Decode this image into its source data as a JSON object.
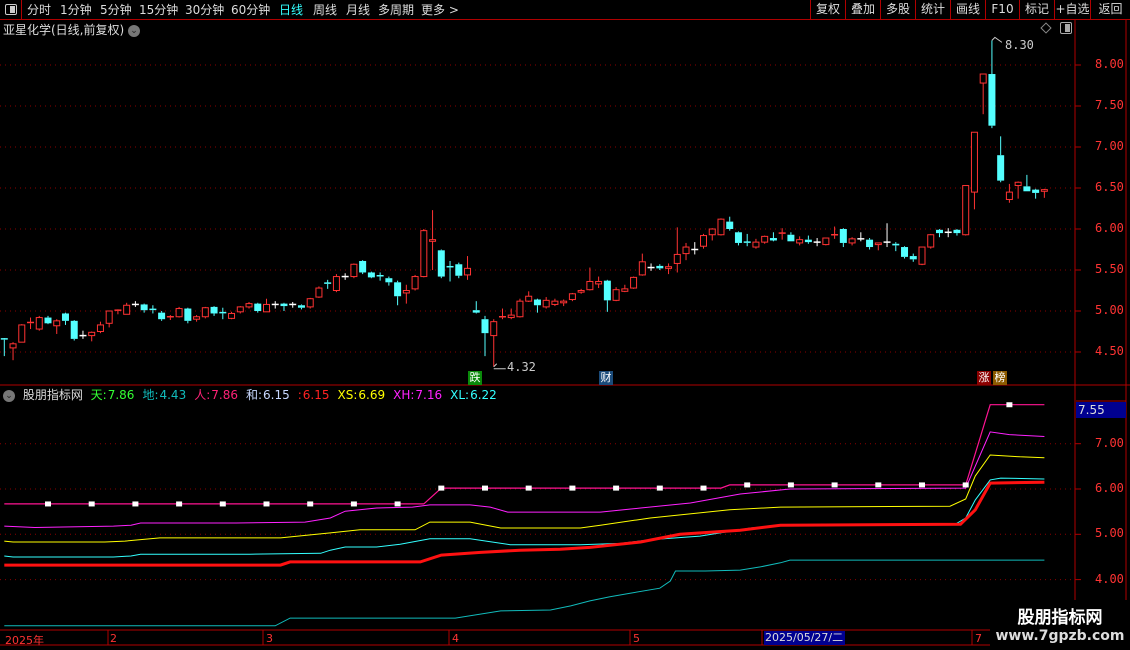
{
  "toolbar": {
    "periods": [
      "分时",
      "1分钟",
      "5分钟",
      "15分钟",
      "30分钟",
      "60分钟",
      "日线",
      "周线",
      "月线",
      "多周期",
      "更多 >"
    ],
    "active_period": "日线",
    "right_buttons": [
      "复权",
      "叠加",
      "多股",
      "统计",
      "画线",
      "F10",
      "标记",
      "+自选",
      "返回"
    ]
  },
  "stock": {
    "title": "亚星化学(日线,前复权)"
  },
  "price_axis": {
    "labels": [
      "8.00",
      "7.50",
      "7.00",
      "6.50",
      "6.00",
      "5.50",
      "5.00",
      "4.50"
    ],
    "values": [
      8,
      7.5,
      7,
      6.5,
      6,
      5.5,
      5,
      4.5
    ]
  },
  "annotations": {
    "high": "8.30",
    "low": "4.32",
    "badges": [
      "跌",
      "财",
      "涨",
      "榜"
    ]
  },
  "indicator": {
    "name": "股朋指标网",
    "items": [
      {
        "label": "天:",
        "value": "7.86",
        "color": "#33ff33"
      },
      {
        "label": "地:",
        "value": "4.43",
        "color": "#11bbbb"
      },
      {
        "label": "人:",
        "value": "7.86",
        "color": "#ff2277"
      },
      {
        "label": "和:",
        "value": "6.15",
        "color": "#c8d8ff"
      },
      {
        "label": ":",
        "value": "6.15",
        "color": "#ff2222"
      },
      {
        "label": "XS:",
        "value": "6.69",
        "color": "#ffff00"
      },
      {
        "label": "XH:",
        "value": "7.16",
        "color": "#ff22ff"
      },
      {
        "label": "XL:",
        "value": "6.22",
        "color": "#33ffff"
      }
    ],
    "axis_labels": [
      "7.00",
      "6.00",
      "5.00",
      "4.00"
    ],
    "axis_values": [
      7,
      6,
      5,
      4
    ],
    "cursor_value": "7.55"
  },
  "date_axis": {
    "labels": [
      "2025年",
      "2",
      "3",
      "4",
      "5",
      "7"
    ],
    "cursor_date": "2025/05/27/二"
  },
  "watermark": {
    "name": "股朋指标网",
    "url": "www.7gpzb.com"
  },
  "colors": {
    "up": "#ff3333",
    "down": "#54ffff",
    "grid": "#8b0000",
    "frame": "#b00000"
  },
  "chart_data": {
    "type": "candlestick",
    "ohlc": [
      [
        4.66,
        4.67,
        4.45,
        4.65
      ],
      [
        4.55,
        4.62,
        4.4,
        4.6
      ],
      [
        4.62,
        4.84,
        4.62,
        4.83
      ],
      [
        4.85,
        4.92,
        4.78,
        4.86
      ],
      [
        4.78,
        4.94,
        4.76,
        4.92
      ],
      [
        4.92,
        4.94,
        4.84,
        4.85
      ],
      [
        4.82,
        4.9,
        4.72,
        4.88
      ],
      [
        4.97,
        4.98,
        4.83,
        4.88
      ],
      [
        4.88,
        4.89,
        4.64,
        4.66
      ],
      [
        4.7,
        4.76,
        4.66,
        4.7
      ],
      [
        4.7,
        4.75,
        4.63,
        4.74
      ],
      [
        4.75,
        4.87,
        4.73,
        4.83
      ],
      [
        4.85,
        5.0,
        4.8,
        5.0
      ],
      [
        5.0,
        5.02,
        4.96,
        5.01
      ],
      [
        4.96,
        5.1,
        4.96,
        5.07
      ],
      [
        5.08,
        5.12,
        5.05,
        5.08
      ],
      [
        5.08,
        5.09,
        4.98,
        5.01
      ],
      [
        5.02,
        5.07,
        4.97,
        5.01
      ],
      [
        4.98,
        5.0,
        4.88,
        4.9
      ],
      [
        4.92,
        4.95,
        4.89,
        4.93
      ],
      [
        4.93,
        5.05,
        4.92,
        5.03
      ],
      [
        5.03,
        5.04,
        4.85,
        4.88
      ],
      [
        4.9,
        4.95,
        4.87,
        4.93
      ],
      [
        4.93,
        5.05,
        4.91,
        5.04
      ],
      [
        5.05,
        5.06,
        4.94,
        4.97
      ],
      [
        4.98,
        5.04,
        4.9,
        4.97
      ],
      [
        4.91,
        4.99,
        4.9,
        4.97
      ],
      [
        4.99,
        5.06,
        4.97,
        5.05
      ],
      [
        5.05,
        5.11,
        5.03,
        5.09
      ],
      [
        5.09,
        5.1,
        4.98,
        5.0
      ],
      [
        4.99,
        5.15,
        4.99,
        5.08
      ],
      [
        5.08,
        5.12,
        5.03,
        5.08
      ],
      [
        5.09,
        5.1,
        5.0,
        5.06
      ],
      [
        5.08,
        5.11,
        5.04,
        5.08
      ],
      [
        5.07,
        5.08,
        5.02,
        5.04
      ],
      [
        5.05,
        5.16,
        5.03,
        5.15
      ],
      [
        5.17,
        5.3,
        5.16,
        5.28
      ],
      [
        5.34,
        5.38,
        5.27,
        5.33
      ],
      [
        5.25,
        5.45,
        5.23,
        5.42
      ],
      [
        5.42,
        5.46,
        5.38,
        5.42
      ],
      [
        5.42,
        5.58,
        5.4,
        5.57
      ],
      [
        5.61,
        5.62,
        5.45,
        5.47
      ],
      [
        5.47,
        5.48,
        5.4,
        5.41
      ],
      [
        5.43,
        5.47,
        5.37,
        5.42
      ],
      [
        5.4,
        5.42,
        5.31,
        5.35
      ],
      [
        5.35,
        5.37,
        5.07,
        5.18
      ],
      [
        5.22,
        5.32,
        5.09,
        5.25
      ],
      [
        5.27,
        5.44,
        5.25,
        5.42
      ],
      [
        5.42,
        6.0,
        5.41,
        5.98
      ],
      [
        5.85,
        6.23,
        5.5,
        5.87
      ],
      [
        5.74,
        5.75,
        5.4,
        5.42
      ],
      [
        5.54,
        5.61,
        5.36,
        5.53
      ],
      [
        5.57,
        5.59,
        5.4,
        5.43
      ],
      [
        5.44,
        5.67,
        5.38,
        5.52
      ],
      [
        5.01,
        5.12,
        4.97,
        4.98
      ],
      [
        4.9,
        4.94,
        4.45,
        4.73
      ],
      [
        4.7,
        4.9,
        4.32,
        4.87
      ],
      [
        4.92,
        5.03,
        4.9,
        4.93
      ],
      [
        4.92,
        5.03,
        4.9,
        4.95
      ],
      [
        4.93,
        5.15,
        4.92,
        5.12
      ],
      [
        5.12,
        5.24,
        5.11,
        5.18
      ],
      [
        5.14,
        5.15,
        4.98,
        5.07
      ],
      [
        5.05,
        5.17,
        5.03,
        5.13
      ],
      [
        5.08,
        5.15,
        5.06,
        5.12
      ],
      [
        5.1,
        5.14,
        5.06,
        5.12
      ],
      [
        5.14,
        5.22,
        5.12,
        5.21
      ],
      [
        5.23,
        5.27,
        5.21,
        5.25
      ],
      [
        5.26,
        5.53,
        5.25,
        5.36
      ],
      [
        5.33,
        5.42,
        5.28,
        5.36
      ],
      [
        5.37,
        5.38,
        4.99,
        5.13
      ],
      [
        5.13,
        5.29,
        5.12,
        5.26
      ],
      [
        5.24,
        5.32,
        5.23,
        5.27
      ],
      [
        5.28,
        5.42,
        5.27,
        5.41
      ],
      [
        5.44,
        5.7,
        5.43,
        5.6
      ],
      [
        5.53,
        5.58,
        5.49,
        5.53
      ],
      [
        5.55,
        5.57,
        5.5,
        5.52
      ],
      [
        5.52,
        5.58,
        5.45,
        5.54
      ],
      [
        5.58,
        6.02,
        5.47,
        5.69
      ],
      [
        5.7,
        5.83,
        5.62,
        5.78
      ],
      [
        5.75,
        5.84,
        5.69,
        5.75
      ],
      [
        5.79,
        5.94,
        5.76,
        5.92
      ],
      [
        5.93,
        6.01,
        5.86,
        6.0
      ],
      [
        5.93,
        6.13,
        5.92,
        6.12
      ],
      [
        6.09,
        6.15,
        5.98,
        6.0
      ],
      [
        5.96,
        5.97,
        5.8,
        5.83
      ],
      [
        5.84,
        5.94,
        5.79,
        5.83
      ],
      [
        5.78,
        5.88,
        5.76,
        5.84
      ],
      [
        5.84,
        5.92,
        5.82,
        5.91
      ],
      [
        5.89,
        5.96,
        5.85,
        5.86
      ],
      [
        5.94,
        6.01,
        5.87,
        5.95
      ],
      [
        5.93,
        5.96,
        5.85,
        5.85
      ],
      [
        5.83,
        5.91,
        5.8,
        5.87
      ],
      [
        5.87,
        5.92,
        5.82,
        5.84
      ],
      [
        5.84,
        5.89,
        5.79,
        5.84
      ],
      [
        5.81,
        5.89,
        5.8,
        5.89
      ],
      [
        5.92,
        6.03,
        5.88,
        5.93
      ],
      [
        6.0,
        6.01,
        5.78,
        5.83
      ],
      [
        5.83,
        5.9,
        5.8,
        5.88
      ],
      [
        5.88,
        5.96,
        5.85,
        5.88
      ],
      [
        5.87,
        5.89,
        5.75,
        5.78
      ],
      [
        5.81,
        5.83,
        5.74,
        5.83
      ],
      [
        5.84,
        6.07,
        5.78,
        5.84
      ],
      [
        5.82,
        5.84,
        5.73,
        5.8
      ],
      [
        5.78,
        5.79,
        5.64,
        5.66
      ],
      [
        5.67,
        5.7,
        5.6,
        5.63
      ],
      [
        5.57,
        5.78,
        5.56,
        5.78
      ],
      [
        5.78,
        5.94,
        5.76,
        5.93
      ],
      [
        5.99,
        6.0,
        5.9,
        5.95
      ],
      [
        5.96,
        6.01,
        5.9,
        5.96
      ],
      [
        5.99,
        6.0,
        5.92,
        5.95
      ],
      [
        5.93,
        6.53,
        5.92,
        6.53
      ],
      [
        6.45,
        7.18,
        6.24,
        7.18
      ],
      [
        7.78,
        7.89,
        7.4,
        7.89
      ],
      [
        7.89,
        8.3,
        7.23,
        7.26
      ],
      [
        6.9,
        7.13,
        6.57,
        6.59
      ],
      [
        6.36,
        6.55,
        6.32,
        6.45
      ],
      [
        6.53,
        6.58,
        6.37,
        6.57
      ],
      [
        6.52,
        6.66,
        6.46,
        6.46
      ],
      [
        6.48,
        6.49,
        6.37,
        6.44
      ],
      [
        6.46,
        6.49,
        6.38,
        6.48
      ]
    ],
    "indicator_series": [
      {
        "name": "天",
        "color": "#ff1493",
        "width": 1.2,
        "points": [
          [
            0,
            5.67
          ],
          [
            48,
            5.67
          ],
          [
            50,
            6.02
          ],
          [
            82,
            6.02
          ],
          [
            83,
            6.09
          ],
          [
            110,
            6.09
          ],
          [
            112.8,
            7.86
          ],
          [
            119,
            7.86
          ]
        ]
      },
      {
        "name": "XH",
        "color": "#ff22ff",
        "width": 1,
        "points": [
          [
            0,
            5.18
          ],
          [
            3.5,
            5.15
          ],
          [
            12.5,
            5.18
          ],
          [
            14.5,
            5.2
          ],
          [
            15.6,
            5.25
          ],
          [
            26.5,
            5.25
          ],
          [
            34.4,
            5.27
          ],
          [
            37.3,
            5.36
          ],
          [
            39,
            5.51
          ],
          [
            42.6,
            5.58
          ],
          [
            46.7,
            5.6
          ],
          [
            48.7,
            5.65
          ],
          [
            53.3,
            5.65
          ],
          [
            55.6,
            5.6
          ],
          [
            57.6,
            5.49
          ],
          [
            68.2,
            5.49
          ],
          [
            72.8,
            5.58
          ],
          [
            78.5,
            5.69
          ],
          [
            84.2,
            5.89
          ],
          [
            89.9,
            6.0
          ],
          [
            110,
            6.02
          ],
          [
            112.8,
            7.26
          ],
          [
            115,
            7.2
          ],
          [
            119,
            7.16
          ]
        ]
      },
      {
        "name": "XS",
        "color": "#ffff00",
        "width": 1,
        "points": [
          [
            0,
            4.85
          ],
          [
            1,
            4.83
          ],
          [
            11.5,
            4.83
          ],
          [
            13.8,
            4.85
          ],
          [
            17.8,
            4.92
          ],
          [
            31.6,
            4.92
          ],
          [
            37.3,
            5.03
          ],
          [
            40.7,
            5.1
          ],
          [
            47,
            5.1
          ],
          [
            48.7,
            5.27
          ],
          [
            53.3,
            5.27
          ],
          [
            56.8,
            5.14
          ],
          [
            65.9,
            5.14
          ],
          [
            68.2,
            5.2
          ],
          [
            73.9,
            5.36
          ],
          [
            83,
            5.54
          ],
          [
            88.8,
            5.6
          ],
          [
            108.2,
            5.62
          ],
          [
            110,
            5.78
          ],
          [
            111.1,
            6.29
          ],
          [
            112.8,
            6.75
          ],
          [
            116.2,
            6.71
          ],
          [
            119,
            6.69
          ]
        ]
      },
      {
        "name": "XL",
        "color": "#33ffff",
        "width": 1,
        "points": [
          [
            0,
            4.52
          ],
          [
            1,
            4.5
          ],
          [
            12.5,
            4.5
          ],
          [
            14.5,
            4.52
          ],
          [
            15.6,
            4.56
          ],
          [
            28.1,
            4.56
          ],
          [
            36.2,
            4.58
          ],
          [
            37.3,
            4.65
          ],
          [
            39,
            4.72
          ],
          [
            42.6,
            4.72
          ],
          [
            45.3,
            4.78
          ],
          [
            48.7,
            4.9
          ],
          [
            53.3,
            4.9
          ],
          [
            57.9,
            4.77
          ],
          [
            65.9,
            4.77
          ],
          [
            70.5,
            4.8
          ],
          [
            73.9,
            4.88
          ],
          [
            79.6,
            4.96
          ],
          [
            85.4,
            5.14
          ],
          [
            88.8,
            5.2
          ],
          [
            108.8,
            5.22
          ],
          [
            110,
            5.36
          ],
          [
            111.1,
            5.76
          ],
          [
            112.8,
            6.2
          ],
          [
            114,
            6.24
          ],
          [
            119,
            6.22
          ]
        ]
      },
      {
        "name": "和",
        "color": "#ff1111",
        "width": 3,
        "points": [
          [
            0,
            4.32
          ],
          [
            31.6,
            4.32
          ],
          [
            32.7,
            4.39
          ],
          [
            47.6,
            4.39
          ],
          [
            50,
            4.54
          ],
          [
            54.5,
            4.6
          ],
          [
            59,
            4.65
          ],
          [
            63.6,
            4.67
          ],
          [
            67,
            4.71
          ],
          [
            72.8,
            4.83
          ],
          [
            77.3,
            5.0
          ],
          [
            84.2,
            5.09
          ],
          [
            88.8,
            5.2
          ],
          [
            109.4,
            5.22
          ],
          [
            111.1,
            5.54
          ],
          [
            112.8,
            6.13
          ],
          [
            119,
            6.15
          ]
        ]
      },
      {
        "name": "地",
        "color": "#11bbbb",
        "width": 1,
        "points": [
          [
            0,
            2.98
          ],
          [
            31,
            2.98
          ],
          [
            32.7,
            3.15
          ],
          [
            51.6,
            3.15
          ],
          [
            56.8,
            3.31
          ],
          [
            62.5,
            3.33
          ],
          [
            64.8,
            3.42
          ],
          [
            67,
            3.53
          ],
          [
            69.3,
            3.62
          ],
          [
            71.6,
            3.7
          ],
          [
            75,
            3.81
          ],
          [
            76.2,
            3.97
          ],
          [
            76.8,
            4.19
          ],
          [
            80.2,
            4.19
          ],
          [
            84.2,
            4.21
          ],
          [
            86.5,
            4.28
          ],
          [
            88.8,
            4.37
          ],
          [
            89.9,
            4.43
          ],
          [
            119,
            4.43
          ]
        ]
      }
    ],
    "marker_every": 5
  }
}
